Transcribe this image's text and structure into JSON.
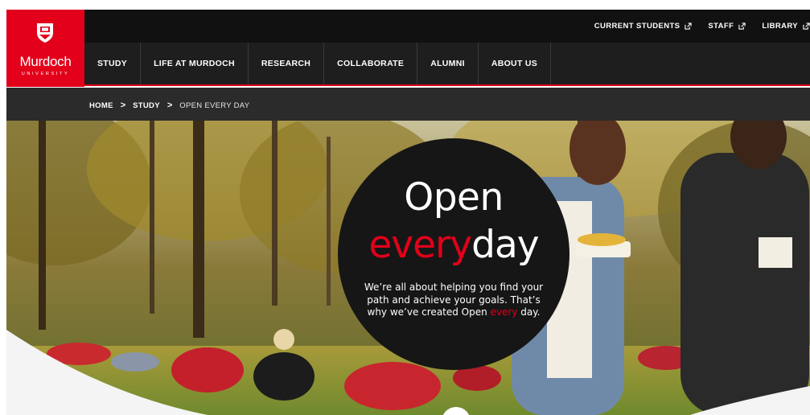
{
  "site": {
    "name": "Murdoch",
    "subname": "UNIVERSITY"
  },
  "utility_links": [
    {
      "label": "CURRENT STUDENTS",
      "icon": "external-link-icon"
    },
    {
      "label": "STAFF",
      "icon": "external-link-icon"
    },
    {
      "label": "LIBRARY",
      "icon": "external-link-icon"
    }
  ],
  "nav": {
    "items": [
      {
        "label": "STUDY"
      },
      {
        "label": "LIFE AT MURDOCH"
      },
      {
        "label": "RESEARCH"
      },
      {
        "label": "COLLABORATE"
      },
      {
        "label": "ALUMNI"
      },
      {
        "label": "ABOUT US"
      }
    ]
  },
  "breadcrumb": {
    "home": "HOME",
    "study": "STUDY",
    "current": "OPEN EVERY DAY",
    "separator": ">"
  },
  "hero": {
    "title_line1": "Open",
    "title_every": "every",
    "title_day": "day",
    "desc_main": "We’re all about helping you find your path and achieve your goals. That’s why we’ve created Open ",
    "desc_every": "every",
    "desc_end": " day."
  },
  "colors": {
    "brand_red": "#e2001a",
    "nav_dark": "#1e1e1e",
    "utility_dark": "#111111",
    "breadcrumb_dark": "#2b2b2b",
    "circle": "#161616"
  }
}
